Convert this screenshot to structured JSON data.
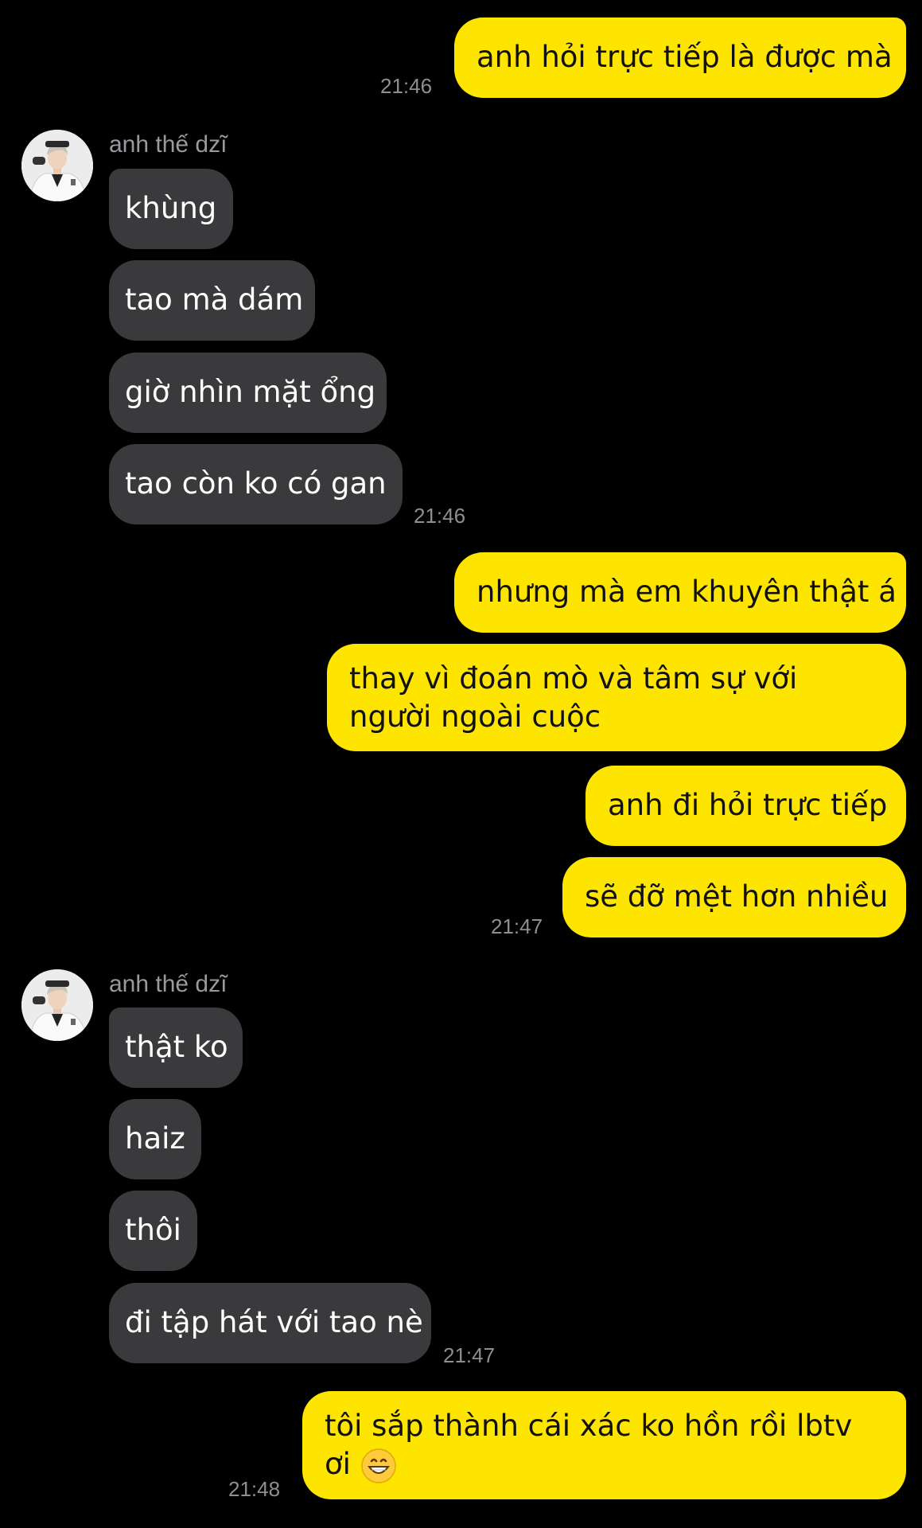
{
  "sender_name": "anh thế dzĩ",
  "messages": {
    "m1": "anh hỏi trực tiếp là được mà",
    "m1_time": "21:46",
    "r1": "khùng",
    "r2": "tao mà dám",
    "r3": "giờ nhìn mặt ổng",
    "r4": "tao còn ko có gan",
    "r4_time": "21:46",
    "m2": "nhưng mà em khuyên thật á",
    "m3": "thay vì đoán mò và tâm sự với người ngoài cuộc",
    "m4": "anh đi hỏi trực tiếp",
    "m5": "sẽ đỡ mệt hơn nhiều",
    "m5_time": "21:47",
    "r5": "thật ko",
    "r6": "haiz",
    "r7": "thôi",
    "r8": "đi tập hát với tao nè",
    "r8_time": "21:47",
    "m6": "tôi sắp thành cái xác ko hồn rồi lbtv ơi",
    "m6_emoji": "grinning-face-emoji",
    "m6_time": "21:48"
  },
  "colors": {
    "my_bubble": "#FEE500",
    "their_bubble": "#3a3a3c",
    "background": "#000000",
    "timestamp": "#8e8e93"
  }
}
